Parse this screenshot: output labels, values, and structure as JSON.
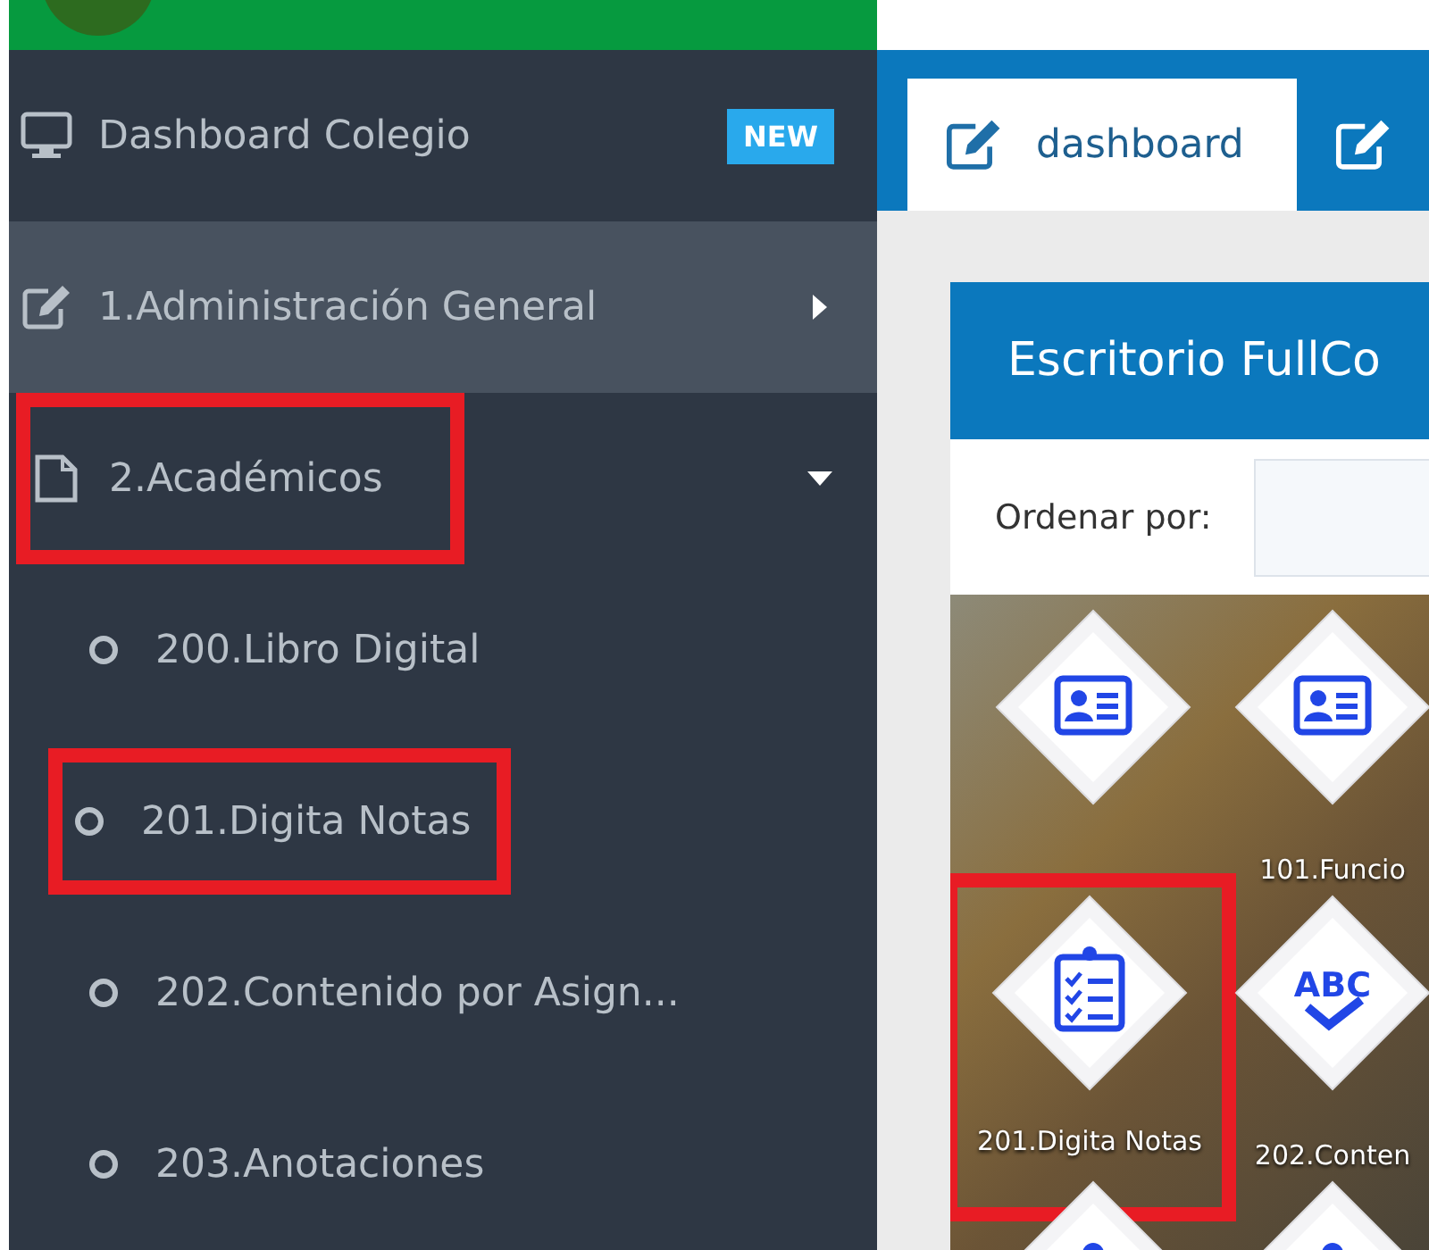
{
  "sidebar": {
    "menu": [
      {
        "label": "Dashboard Colegio",
        "kind": "monitor",
        "badge": "NEW",
        "selected": false,
        "highlighted": false
      },
      {
        "label": "1.Administración General",
        "kind": "edit",
        "selected": true,
        "expanded": false,
        "highlighted": false
      },
      {
        "label": "2.Académicos",
        "kind": "document",
        "selected": false,
        "expanded": true,
        "highlighted": true,
        "children": [
          {
            "label": "200.Libro Digital",
            "highlighted": false
          },
          {
            "label": "201.Digita Notas",
            "highlighted": true
          },
          {
            "label": "202.Contenido por Asign...",
            "highlighted": false
          },
          {
            "label": "203.Anotaciones",
            "highlighted": false
          }
        ]
      }
    ]
  },
  "tabs": [
    {
      "label": "dashboard",
      "selected": true
    },
    {
      "selected": false
    }
  ],
  "panel": {
    "title": "Escritorio FullCo",
    "sort_label": "Ordenar por:",
    "tiles": [
      {
        "kind": "id-card",
        "highlighted": false
      },
      {
        "kind": "id-card",
        "label": "101.Funcio",
        "highlighted": false
      },
      {
        "kind": "checklist",
        "label": "201.Digita Notas",
        "highlighted": true
      },
      {
        "kind": "abc-check",
        "icon_text": "ABC",
        "label": "202.Conten",
        "highlighted": false
      },
      {
        "kind": "person",
        "highlighted": false
      },
      {
        "kind": "person",
        "highlighted": false
      }
    ]
  }
}
